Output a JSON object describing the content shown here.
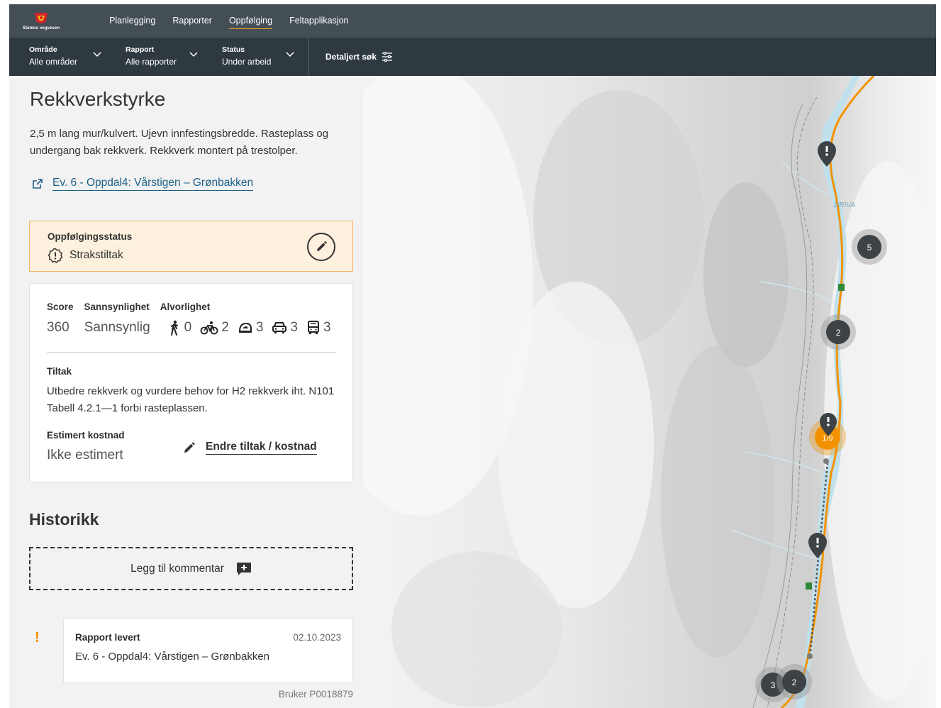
{
  "logo": {
    "text": "Statens vegvesen"
  },
  "nav": {
    "items": [
      {
        "label": "Planlegging",
        "active": false
      },
      {
        "label": "Rapporter",
        "active": false
      },
      {
        "label": "Oppfølging",
        "active": true
      },
      {
        "label": "Feltapplikasjon",
        "active": false
      }
    ]
  },
  "filters": [
    {
      "label": "Område",
      "value": "Alle områder"
    },
    {
      "label": "Rapport",
      "value": "Alle rapporter"
    },
    {
      "label": "Status",
      "value": "Under arbeid"
    }
  ],
  "detailed_search": "Detaljert søk",
  "panel": {
    "title": "Rekkverkstyrke",
    "description": "2,5 m lang mur/kulvert. Ujevn innfestingsbredde. Rasteplass og undergang bak rekkverk. Rekkverk montert på trestolper.",
    "link": "Ev. 6 - Oppdal4: Vårstigen – Grønbakken",
    "status": {
      "title": "Oppfølgingsstatus",
      "value": "Strakstiltak"
    },
    "score": {
      "labels": {
        "score": "Score",
        "probability": "Sannsynlighet",
        "severity": "Alvorlighet"
      },
      "score_value": "360",
      "probability_value": "Sannsynlig",
      "severity": [
        {
          "icon": "pedestrian-icon",
          "value": "0"
        },
        {
          "icon": "bicycle-icon",
          "value": "2"
        },
        {
          "icon": "moped-icon",
          "value": "3"
        },
        {
          "icon": "car-icon",
          "value": "3"
        },
        {
          "icon": "bus-icon",
          "value": "3"
        }
      ]
    },
    "tiltak": {
      "title": "Tiltak",
      "text": "Utbedre rekkverk og vurdere behov for H2 rekkverk iht. N101 Tabell 4.2.1—1 forbi rasteplassen."
    },
    "cost": {
      "title": "Estimert kostnad",
      "value": "Ikke estimert",
      "edit_label": "Endre tiltak / kostnad"
    },
    "history": {
      "title": "Historikk",
      "add_comment": "Legg til kommentar",
      "entries": [
        {
          "title": "Rapport levert",
          "date": "02.10.2023",
          "subtitle": "Ev. 6 - Oppdal4: Vårstigen – Grønbakken",
          "user": "Bruker P0018879"
        }
      ]
    }
  },
  "map": {
    "river_label": "DRIVA",
    "clusters": [
      "5",
      "2",
      "1/9",
      "3",
      "2"
    ],
    "colors": {
      "road": "#f39200",
      "river": "#bfe0ec",
      "marker": "#3c4246"
    }
  }
}
